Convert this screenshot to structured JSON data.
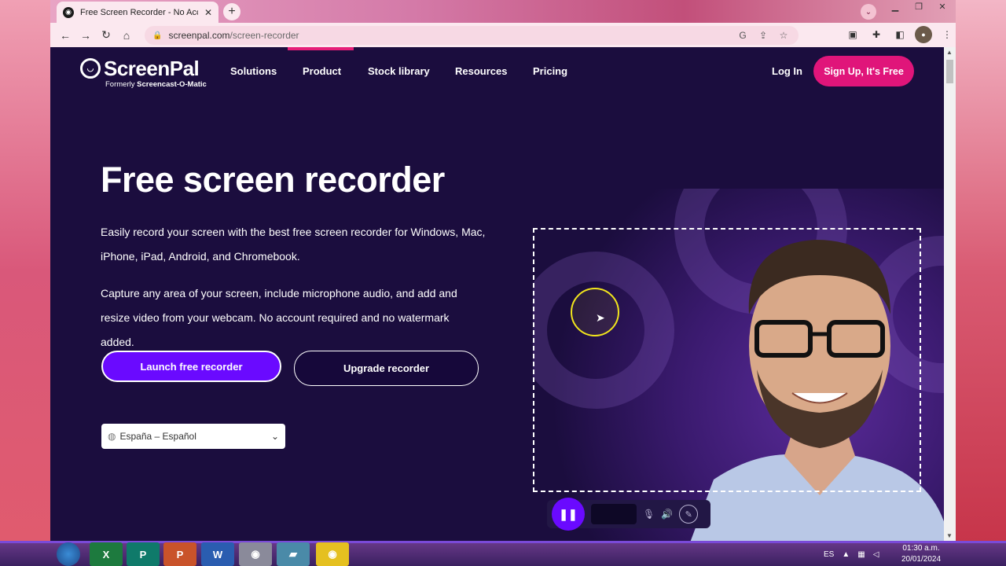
{
  "browser": {
    "tab_title": "Free Screen Recorder - No Accou",
    "url_host": "screenpal.com",
    "url_path": "/screen-recorder"
  },
  "site": {
    "logo_word": "ScreenPal",
    "logo_sub_prefix": "Formerly ",
    "logo_sub_bold": "Screencast-O-Matic",
    "nav": [
      "Solutions",
      "Product",
      "Stock library",
      "Resources",
      "Pricing"
    ],
    "login": "Log In",
    "signup": "Sign Up, It's Free"
  },
  "hero": {
    "title": "Free screen recorder",
    "para1": "Easily record your screen with the best free screen recorder for Windows, Mac, iPhone, iPad, Android, and Chromebook.",
    "para2": "Capture any area of your screen, include microphone audio, and add and resize video from your webcam. No account required and no watermark added.",
    "launch_button": "Launch free recorder",
    "upgrade_button": "Upgrade recorder",
    "language_select": "España – Español"
  },
  "taskbar": {
    "apps": [
      "excel",
      "publisher",
      "powerpoint",
      "word",
      "chrome",
      "app",
      "screenpal"
    ],
    "lang": "ES",
    "time": "01:30 a.m.",
    "date": "20/01/2024"
  },
  "colors": {
    "page_bg": "#1b0d3e",
    "primary": "#6a0aff",
    "signup": "#e0157a",
    "accent_bar": "#e61e78"
  }
}
